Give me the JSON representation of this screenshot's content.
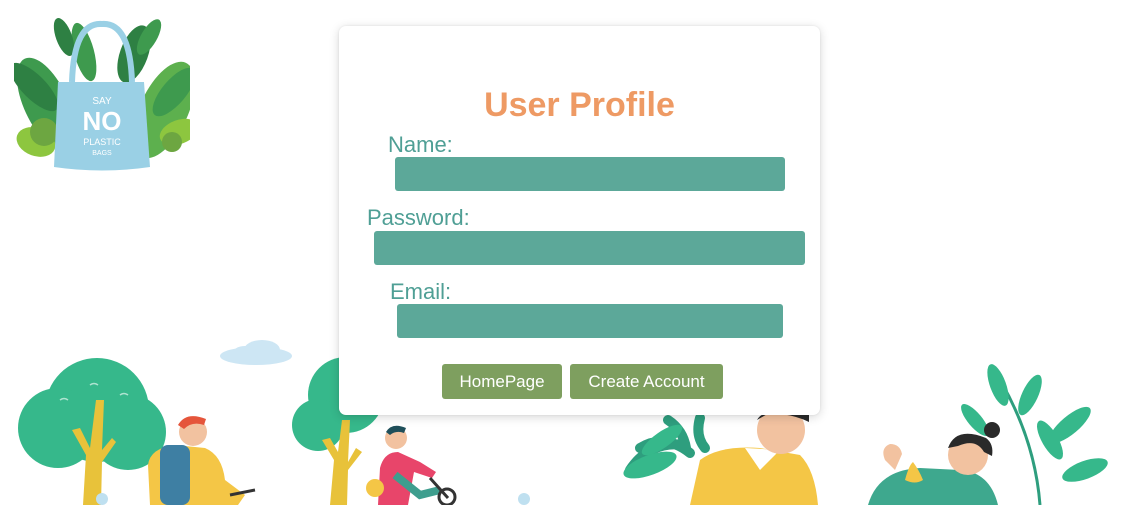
{
  "profile": {
    "title": "User Profile",
    "fields": {
      "name": {
        "label": "Name:",
        "value": ""
      },
      "password": {
        "label": "Password:",
        "value": ""
      },
      "email": {
        "label": "Email:",
        "value": ""
      }
    },
    "buttons": {
      "homepage": "HomePage",
      "create_account": "Create Account"
    }
  },
  "logo": {
    "line1": "SAY",
    "line2": "NO",
    "line3": "PLASTIC",
    "line4": "BAGS"
  },
  "colors": {
    "title": "#EE9A64",
    "label": "#4F9F95",
    "input": "#5CA899",
    "button": "#7E9F5F"
  }
}
